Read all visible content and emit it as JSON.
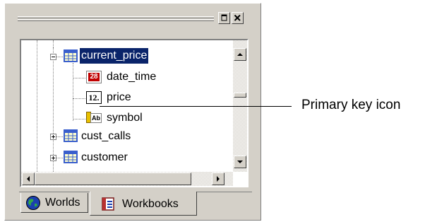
{
  "toolbar": {
    "restore_icon": "restore-icon",
    "close_icon": "close-icon"
  },
  "tree": {
    "items": [
      {
        "label": "current_price",
        "icon": "table-icon",
        "expanded": true,
        "selected": true
      },
      {
        "label": "date_time",
        "icon": "datetime-field-icon"
      },
      {
        "label": "price",
        "icon": "numeric-field-icon",
        "icon_text": "12."
      },
      {
        "label": "symbol",
        "icon": "primary-key-field-icon"
      },
      {
        "label": "cust_calls",
        "icon": "table-icon",
        "expanded": false
      },
      {
        "label": "customer",
        "icon": "table-icon",
        "expanded": false
      }
    ],
    "datetime_icon_text": "28",
    "key_icon_text": "Ab"
  },
  "tabs": [
    {
      "label": "Worlds",
      "icon": "globe-icon",
      "active": false
    },
    {
      "label": "Workbooks",
      "icon": "workbook-icon",
      "active": true
    }
  ],
  "callout": {
    "text": "Primary key icon"
  },
  "colors": {
    "selection": "#0a246a",
    "chrome": "#d4d0c8",
    "table_icon": "#3a5fcd"
  }
}
